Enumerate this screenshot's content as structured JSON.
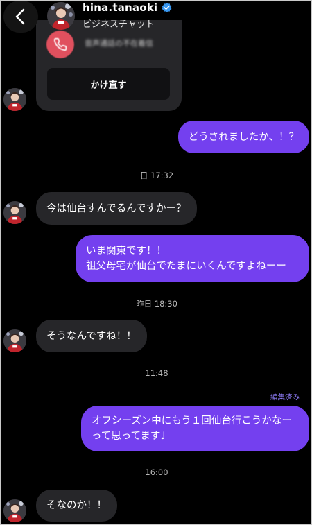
{
  "header": {
    "username": "hina.tanaoki",
    "chat_type": "ビジネスチャット",
    "verified_icon": "verified-badge-icon",
    "back_icon": "chevron-left-icon"
  },
  "call_card": {
    "missed_call_text": "音声通話の不在着信",
    "callback_label": "かけ直す",
    "icon": "phone-missed-icon"
  },
  "messages": [
    {
      "text": "どうされましたか、！？"
    },
    {
      "text": "今は仙台すんでるんですかー？"
    },
    {
      "lines": [
        "いま関東です！！",
        "祖父母宅が仙台でたまにいくんですよねーー"
      ]
    },
    {
      "text": "そうなんですね！！"
    },
    {
      "lines": [
        "オフシーズン中にもう１回仙台行こうかなー",
        "って思ってます♩"
      ]
    },
    {
      "text": "そなのか！！"
    }
  ],
  "timestamps": [
    "日 17:32",
    "昨日 18:30",
    "11:48",
    "16:00"
  ],
  "edited_label": "編集済み",
  "colors": {
    "outgoing_bubble": "#7440ef",
    "incoming_bubble": "#262629",
    "background": "#000000",
    "edited_label": "#8e7cf6",
    "verified": "#3897f0"
  }
}
